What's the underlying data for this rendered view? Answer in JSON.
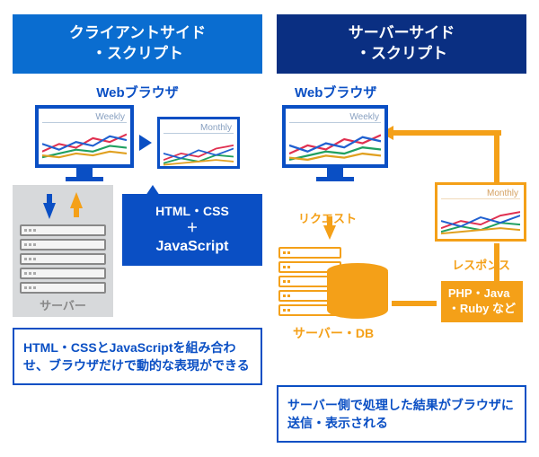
{
  "left": {
    "header": "クライアントサイド\n・スクリプト",
    "browser_title": "Webブラウザ",
    "screen1_label": "Weekly",
    "screen2_label": "Monthly",
    "callout_line1": "HTML・CSS",
    "callout_plus": "＋",
    "callout_js": "JavaScript",
    "server_label": "サーバー",
    "bottom": "HTML・CSSとJavaScriptを組み合わせ、ブラウザだけで動的な表現ができる"
  },
  "right": {
    "header": "サーバーサイド\n・スクリプト",
    "browser_title": "Webブラウザ",
    "screen_label": "Weekly",
    "request_label": "リクエスト",
    "server_db_label": "サーバー・DB",
    "response_screen_label": "Monthly",
    "response_label": "レスポンス",
    "lang_line1": "PHP・Java",
    "lang_line2": "・Ruby など",
    "bottom": "サーバー側で処理した結果がブラウザに送信・表示される"
  }
}
